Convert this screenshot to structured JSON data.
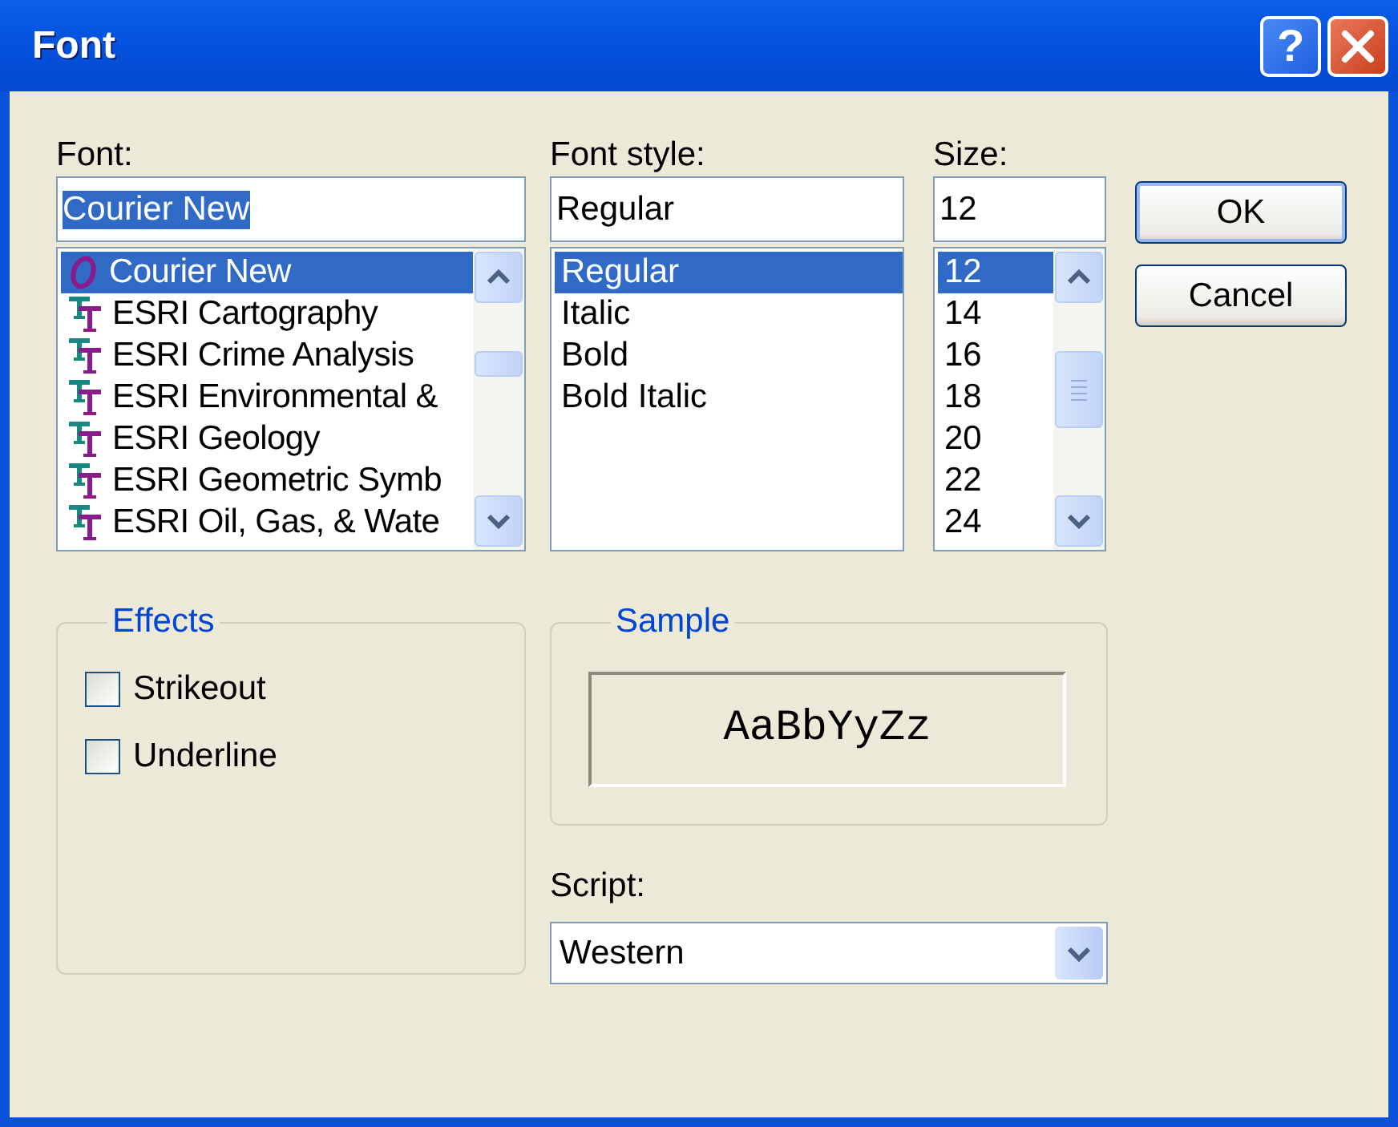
{
  "window": {
    "title": "Font",
    "help": "?"
  },
  "font": {
    "label": "Font:",
    "value": "Courier New",
    "value_selected": true,
    "items": [
      {
        "name": "Courier New",
        "kind": "opentype",
        "selected": true
      },
      {
        "name": "ESRI Cartography",
        "kind": "truetype",
        "selected": false
      },
      {
        "name": "ESRI Crime Analysis",
        "kind": "truetype",
        "selected": false
      },
      {
        "name": "ESRI Environmental &",
        "kind": "truetype",
        "selected": false
      },
      {
        "name": "ESRI Geology",
        "kind": "truetype",
        "selected": false
      },
      {
        "name": "ESRI Geometric Symb",
        "kind": "truetype",
        "selected": false
      },
      {
        "name": "ESRI Oil, Gas, & Wate",
        "kind": "truetype",
        "selected": false
      }
    ]
  },
  "font_style": {
    "label": "Font style:",
    "value": "Regular",
    "items": [
      {
        "name": "Regular",
        "selected": true
      },
      {
        "name": "Italic",
        "selected": false
      },
      {
        "name": "Bold",
        "selected": false
      },
      {
        "name": "Bold Italic",
        "selected": false
      }
    ]
  },
  "size": {
    "label": "Size:",
    "value": "12",
    "items": [
      {
        "name": "12",
        "selected": true
      },
      {
        "name": "14",
        "selected": false
      },
      {
        "name": "16",
        "selected": false
      },
      {
        "name": "18",
        "selected": false
      },
      {
        "name": "20",
        "selected": false
      },
      {
        "name": "22",
        "selected": false
      },
      {
        "name": "24",
        "selected": false
      }
    ]
  },
  "buttons": [
    {
      "label": "OK",
      "default": true
    },
    {
      "label": "Cancel",
      "default": false
    }
  ],
  "effects": {
    "title": "Effects",
    "options": [
      {
        "label": "Strikeout",
        "checked": false
      },
      {
        "label": "Underline",
        "checked": false
      }
    ]
  },
  "sample": {
    "title": "Sample",
    "text": "AaBbYyZz"
  },
  "script": {
    "label": "Script:",
    "value": "Western"
  }
}
